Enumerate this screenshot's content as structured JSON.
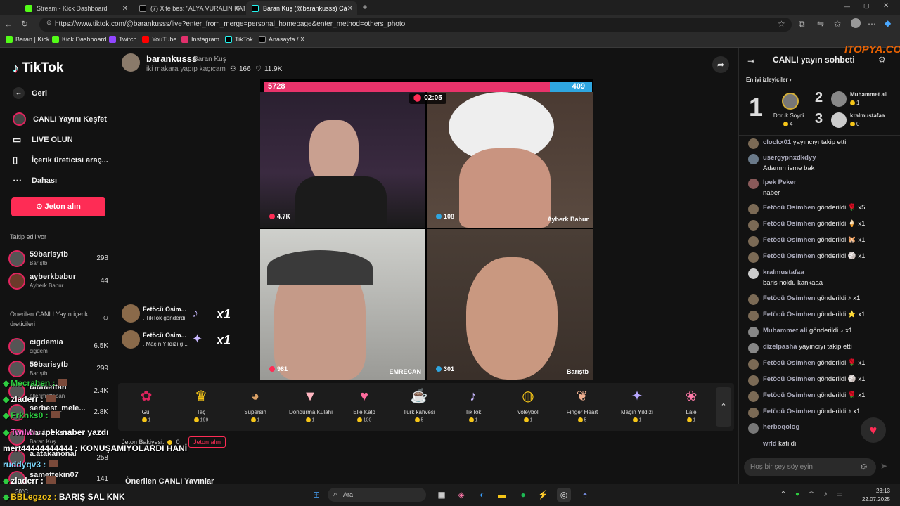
{
  "browser": {
    "tabs": [
      {
        "label": "Stream - Kick Dashboard",
        "color": "#53fc18"
      },
      {
        "label": "(7) X'te bes: \"ALYA VURALIN KATI",
        "color": "#000000"
      },
      {
        "label": "Baran Kuş (@barankusss) Cá",
        "color": "#000000"
      }
    ],
    "new_tab": "+",
    "url": "https://www.tiktok.com/@barankusss/live?enter_from_merge=personal_homepage&enter_method=others_photo",
    "bookmarks": [
      "Baran | Kick",
      "Kick Dashboard",
      "Twitch",
      "YouTube",
      "Instagram",
      "TikTok",
      "Anasayfa / X"
    ]
  },
  "sidebar": {
    "logo": "TikTok",
    "nav": [
      {
        "label": "Geri",
        "icon": "←"
      },
      {
        "label": "CANLI Yayını Keşfet",
        "icon": "◉"
      },
      {
        "label": "LIVE OLUN",
        "icon": "▭"
      },
      {
        "label": "İçerik üreticisi araç...",
        "icon": "▯"
      },
      {
        "label": "Dahası",
        "icon": "⋯"
      }
    ],
    "coin_button": "Jeton alın",
    "following_title": "Takip ediliyor",
    "following": [
      {
        "name": "59barisytb",
        "sub": "Barıştb",
        "count": "298"
      },
      {
        "name": "ayberkbabur",
        "sub": "Ayberk Babur",
        "count": "44"
      }
    ],
    "suggested_title": "Önerilen CANLI Yayın içerik üreticileri",
    "suggested": [
      {
        "name": "cigdemia",
        "sub": "cigdem",
        "count": "6.5K"
      },
      {
        "name": "59barisytb",
        "sub": "Barıştb",
        "count": "299"
      },
      {
        "name": "oldmeftan",
        "sub": "ellerimefteban",
        "count": "2.4K"
      },
      {
        "name": "serbest_mele...",
        "sub": "",
        "count": "2.8K"
      },
      {
        "name": "barankusss",
        "sub": "Baran Kuş",
        "count": ""
      },
      {
        "name": "a.atakanonal",
        "sub": "",
        "count": "258"
      },
      {
        "name": "samettekin07",
        "sub": "",
        "count": "141"
      }
    ]
  },
  "stream": {
    "username": "barankusss",
    "display_name": "Baran Kuş",
    "title": "iki makara yapıp kaçıcam",
    "viewers": "166",
    "likes": "11.9K",
    "score_left": "5728",
    "score_right": "409",
    "timer": "02:05",
    "cells": [
      {
        "count": "4.7K",
        "label": ""
      },
      {
        "count": "108",
        "label": "Ayberk Babur"
      },
      {
        "count": "981",
        "label": "EMRECAN"
      },
      {
        "count": "301",
        "label": "Barıştb"
      }
    ],
    "gift_notifications": [
      {
        "user": "Fetöcü Osim...",
        "desc": ", TikTok gönderdi",
        "mult": "x1"
      },
      {
        "user": "Fetöcü Osim...",
        "desc": ", Maçın Yıldızı g...",
        "mult": "x1"
      }
    ]
  },
  "gifts": [
    {
      "name": "Gül",
      "price": "1",
      "icon": "🌹"
    },
    {
      "name": "Taç",
      "price": "199",
      "icon": "👑"
    },
    {
      "name": "Süpersin",
      "price": "1",
      "icon": "🐹"
    },
    {
      "name": "Dondurma Külahı",
      "price": "1",
      "icon": "🍦"
    },
    {
      "name": "Elle Kalp",
      "price": "100",
      "icon": "🫶"
    },
    {
      "name": "Türk kahvesi",
      "price": "5",
      "icon": "☕"
    },
    {
      "name": "TikTok",
      "price": "1",
      "icon": "♪"
    },
    {
      "name": "voleybol",
      "price": "1",
      "icon": "🏐"
    },
    {
      "name": "Finger Heart",
      "price": "5",
      "icon": "🫰"
    },
    {
      "name": "Maçın Yıldızı",
      "price": "1",
      "icon": "⭐"
    },
    {
      "name": "Lale",
      "price": "1",
      "icon": "🌷"
    }
  ],
  "balance": {
    "label": "Jeton Bakiyesi:",
    "value": "0",
    "button": "Jeton alın"
  },
  "suggested_live": "Önerilen CANLI Yayınlar",
  "chat": {
    "title": "CANLI yayın sohbeti",
    "watermark": "ITOPYA.COM",
    "top_viewers_label": "En iyi izleyiciler",
    "top": [
      {
        "rank": "1",
        "name": "Doruk Soydi...",
        "coins": "4"
      },
      {
        "rank": "2",
        "name": "Muhammet ali",
        "coins": "1"
      },
      {
        "rank": "3",
        "name": "kralmustafaa",
        "coins": "0"
      }
    ],
    "messages": [
      {
        "user": "clockx01",
        "text": "yayıncıyı takip etti"
      },
      {
        "user": "usergypnxdkdyy",
        "text": "Adamın isme bak"
      },
      {
        "user": "İpek Peker",
        "text": "naber"
      },
      {
        "user": "Fetöcü Osimhen",
        "text": "gönderildi 🌹 x5"
      },
      {
        "user": "Fetöcü Osimhen",
        "text": "gönderildi 🍦 x1"
      },
      {
        "user": "Fetöcü Osimhen",
        "text": "gönderildi 🐹 x1"
      },
      {
        "user": "Fetöcü Osimhen",
        "text": "gönderildi 🏐 x1"
      },
      {
        "user": "kralmustafaa",
        "text": "baris noldu kankaaa"
      },
      {
        "user": "Fetöcü Osimhen",
        "text": "gönderildi ♪ x1"
      },
      {
        "user": "Fetöcü Osimhen",
        "text": "gönderildi ⭐ x1"
      },
      {
        "user": "Muhammet ali",
        "text": "gönderildi ♪ x1"
      },
      {
        "user": "dizelpasha",
        "text": "yayıncıyı takip etti"
      },
      {
        "user": "Fetöcü Osimhen",
        "text": "gönderildi 🌹 x1"
      },
      {
        "user": "Fetöcü Osimhen",
        "text": "gönderildi 🏐 x1"
      },
      {
        "user": "Fetöcü Osimhen",
        "text": "gönderildi 🌹 x1"
      },
      {
        "user": "Fetöcü Osimhen",
        "text": "gönderildi ♪ x1"
      },
      {
        "user": "herboqolog",
        "text": ""
      },
      {
        "user": "wrld",
        "text": "katıldı"
      }
    ],
    "input_placeholder": "Hoş bir şey söyleyin"
  },
  "overlay_chat": [
    {
      "user": "Mecrahen :",
      "text": ""
    },
    {
      "user": "zladerr :",
      "text": ""
    },
    {
      "user": "Frknks0 :",
      "text": ""
    },
    {
      "user": "Twilwi :",
      "text": "ipek naber yazdı"
    },
    {
      "user": "mert44444444444 :",
      "text": "KONUŞAMIYOLARDI HANİ"
    },
    {
      "user": "ruddyqv3 :",
      "text": ""
    },
    {
      "user": "zladerr :",
      "text": ""
    },
    {
      "user": "BBLegzoz :",
      "text": "BARIŞ SAL KNK"
    }
  ],
  "taskbar": {
    "search": "Ara",
    "temp": "30°C",
    "time": "23:13",
    "date": "22.07.2025"
  }
}
